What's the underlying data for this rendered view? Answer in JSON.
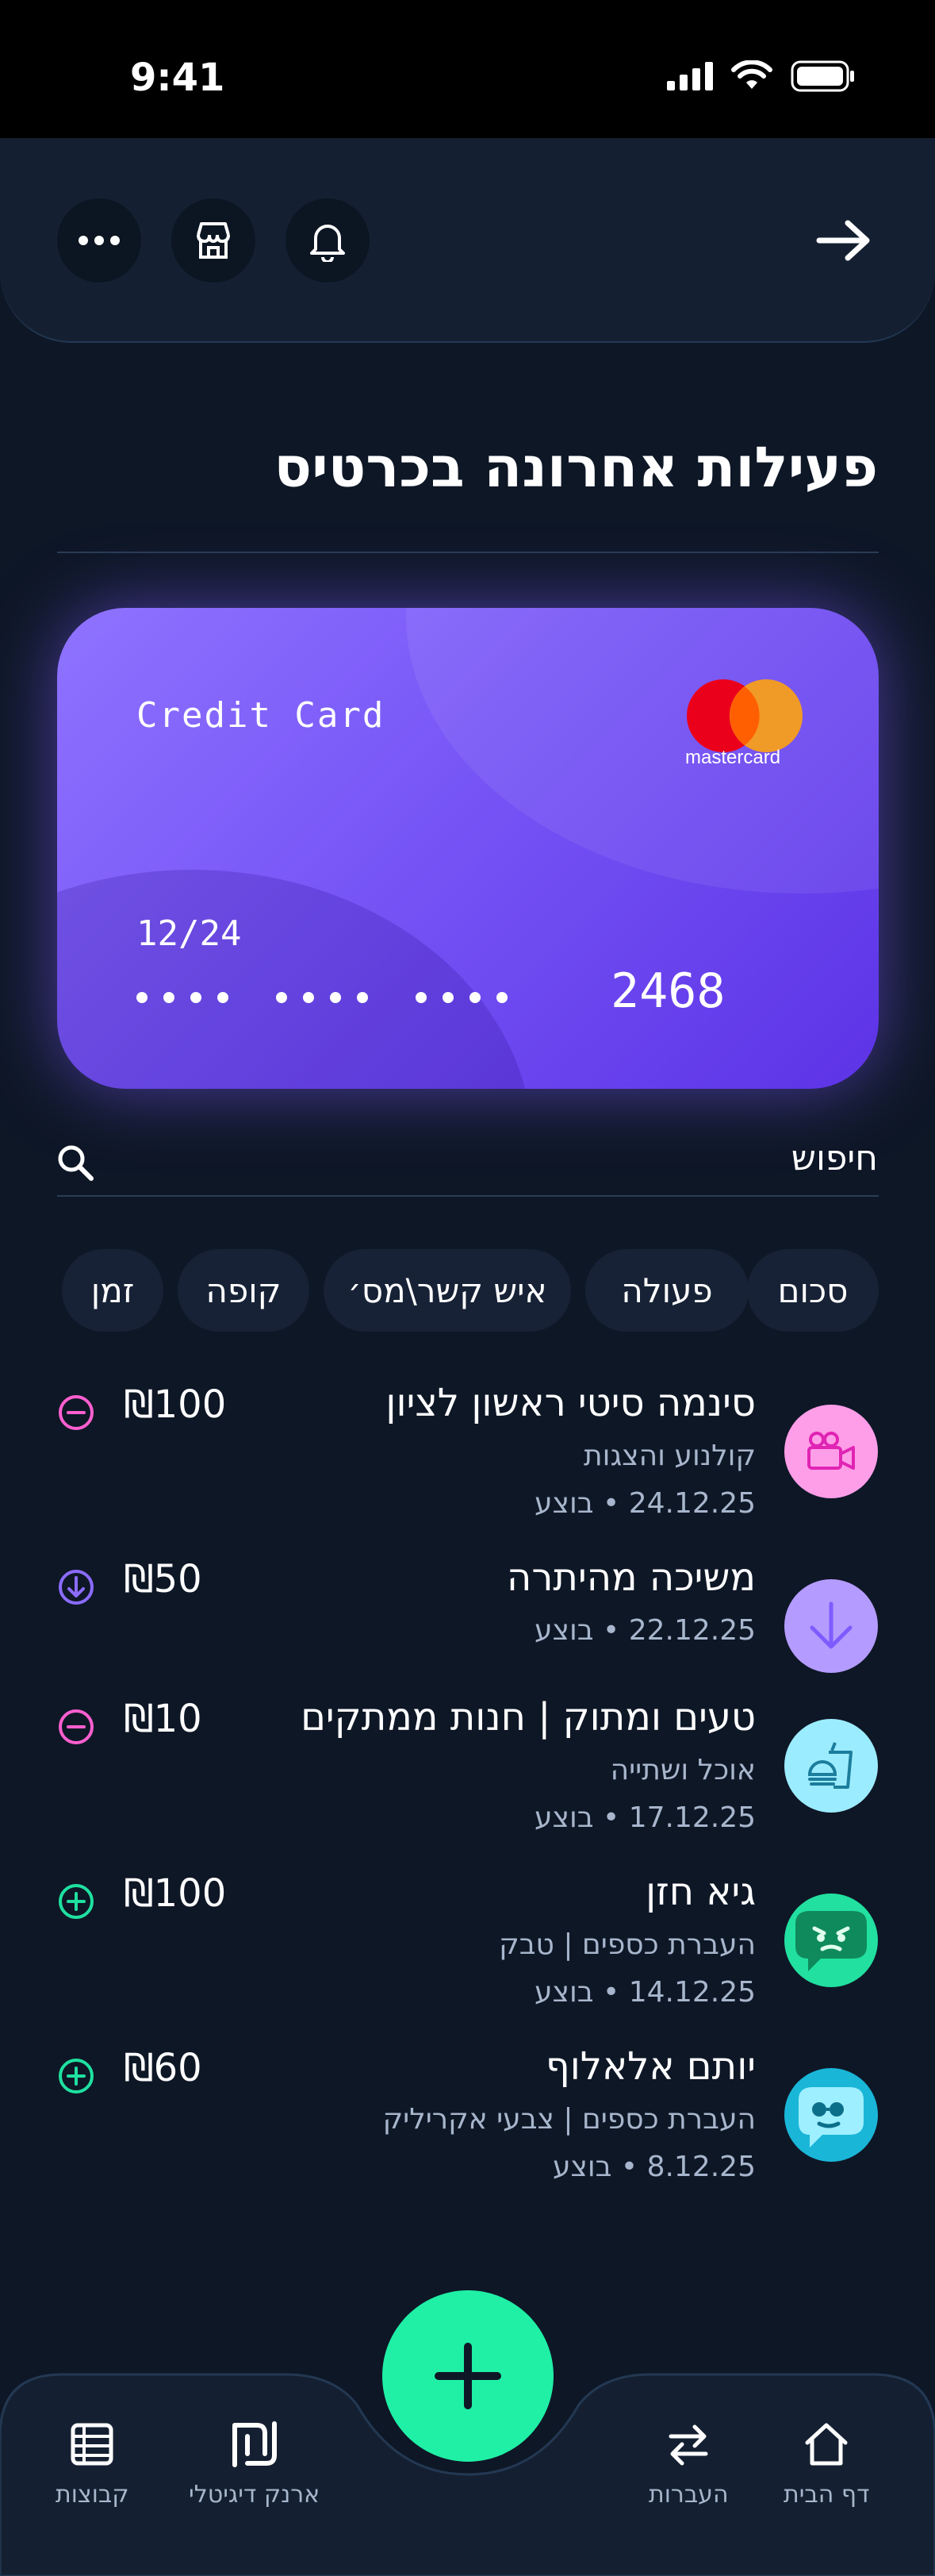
{
  "status_bar": {
    "time": "9:41"
  },
  "header": {
    "title": "פעילות אחרונה בכרטיס"
  },
  "card": {
    "label": "Credit Card",
    "brand": "mastercard",
    "expiry": "12/24",
    "last4": "2468"
  },
  "search": {
    "label": "חיפוש"
  },
  "filters": [
    "זמן",
    "קופה",
    "איש קשר\\מס׳",
    "פעולה",
    "סכום"
  ],
  "transactions": [
    {
      "title": "סינמה סיטי ראשון לציון",
      "category": "קולנוע והצגות",
      "meta": "24.12.25 • בוצע",
      "amount": "₪100",
      "type": "debit",
      "icon": "camera-icon"
    },
    {
      "title": "משיכה מהיתרה",
      "category": "",
      "meta": "22.12.25 • בוצע",
      "amount": "₪50",
      "type": "withdraw",
      "icon": "arrow-down-icon"
    },
    {
      "title": "טעים ומתוק | חנות ממתקים",
      "category": "אוכל ושתייה",
      "meta": "17.12.25 • בוצע",
      "amount": "₪10",
      "type": "debit",
      "icon": "food-icon"
    },
    {
      "title": "גיא חזן",
      "category": "העברת כספים | טבק",
      "meta": "14.12.25 • בוצע",
      "amount": "₪100",
      "type": "credit",
      "icon": "avatar-green-icon"
    },
    {
      "title": "יותם אלאלוף",
      "category": "העברת כספים | צבעי אקריליק",
      "meta": "8.12.25 • בוצע",
      "amount": "₪60",
      "type": "credit",
      "icon": "avatar-cyan-icon"
    }
  ],
  "nav": {
    "home": "דף הבית",
    "transfers": "העברות",
    "wallet": "ארנק דיגיטלי",
    "groups": "קבוצות"
  },
  "colors": {
    "background": "#0e1726",
    "accent_green": "#1ff0a6",
    "debit_pink": "#ff5fd0",
    "withdraw_purple": "#8b6cff",
    "credit_green": "#1fe0a0"
  }
}
